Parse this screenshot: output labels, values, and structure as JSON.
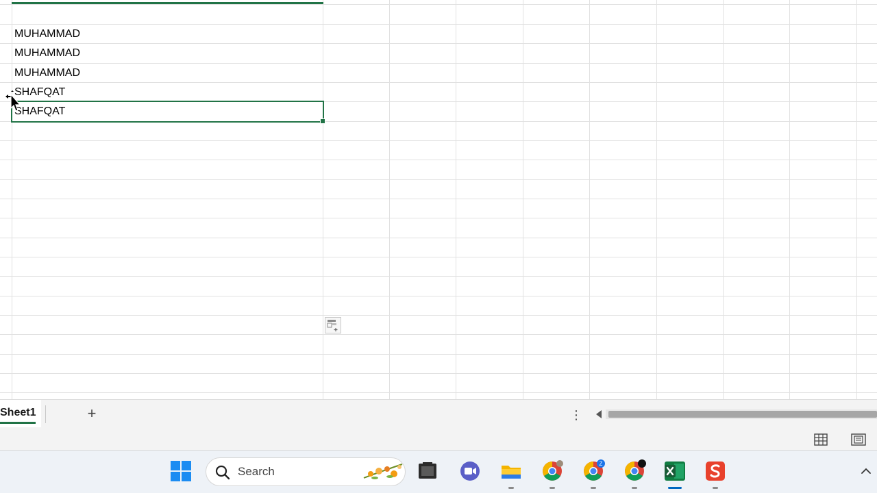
{
  "grid": {
    "cells": [
      {
        "row": 1,
        "value": "MUHAMMAD"
      },
      {
        "row": 2,
        "value": "MUHAMMAD"
      },
      {
        "row": 3,
        "value": "MUHAMMAD"
      },
      {
        "row": 4,
        "value": "SHAFQAT"
      },
      {
        "row": 5,
        "value": "SHAFQAT"
      }
    ],
    "selection_color": "#217346"
  },
  "sheet_tabs": {
    "tabs": [
      {
        "label": "Sheet1",
        "active": true
      }
    ],
    "add_label": "+",
    "more_label": "⋮"
  },
  "taskbar": {
    "search_label": "Search",
    "apps": [
      "start-icon",
      "file-manager-icon",
      "video-call-icon",
      "folder-icon",
      "chrome-icon",
      "chrome-profile-icon",
      "chrome-icon",
      "excel-icon",
      "office-s-icon"
    ]
  },
  "colors": {
    "excel_green": "#217346",
    "taskbar_bg": "#eef2f7",
    "accent_blue": "#0067c0"
  }
}
